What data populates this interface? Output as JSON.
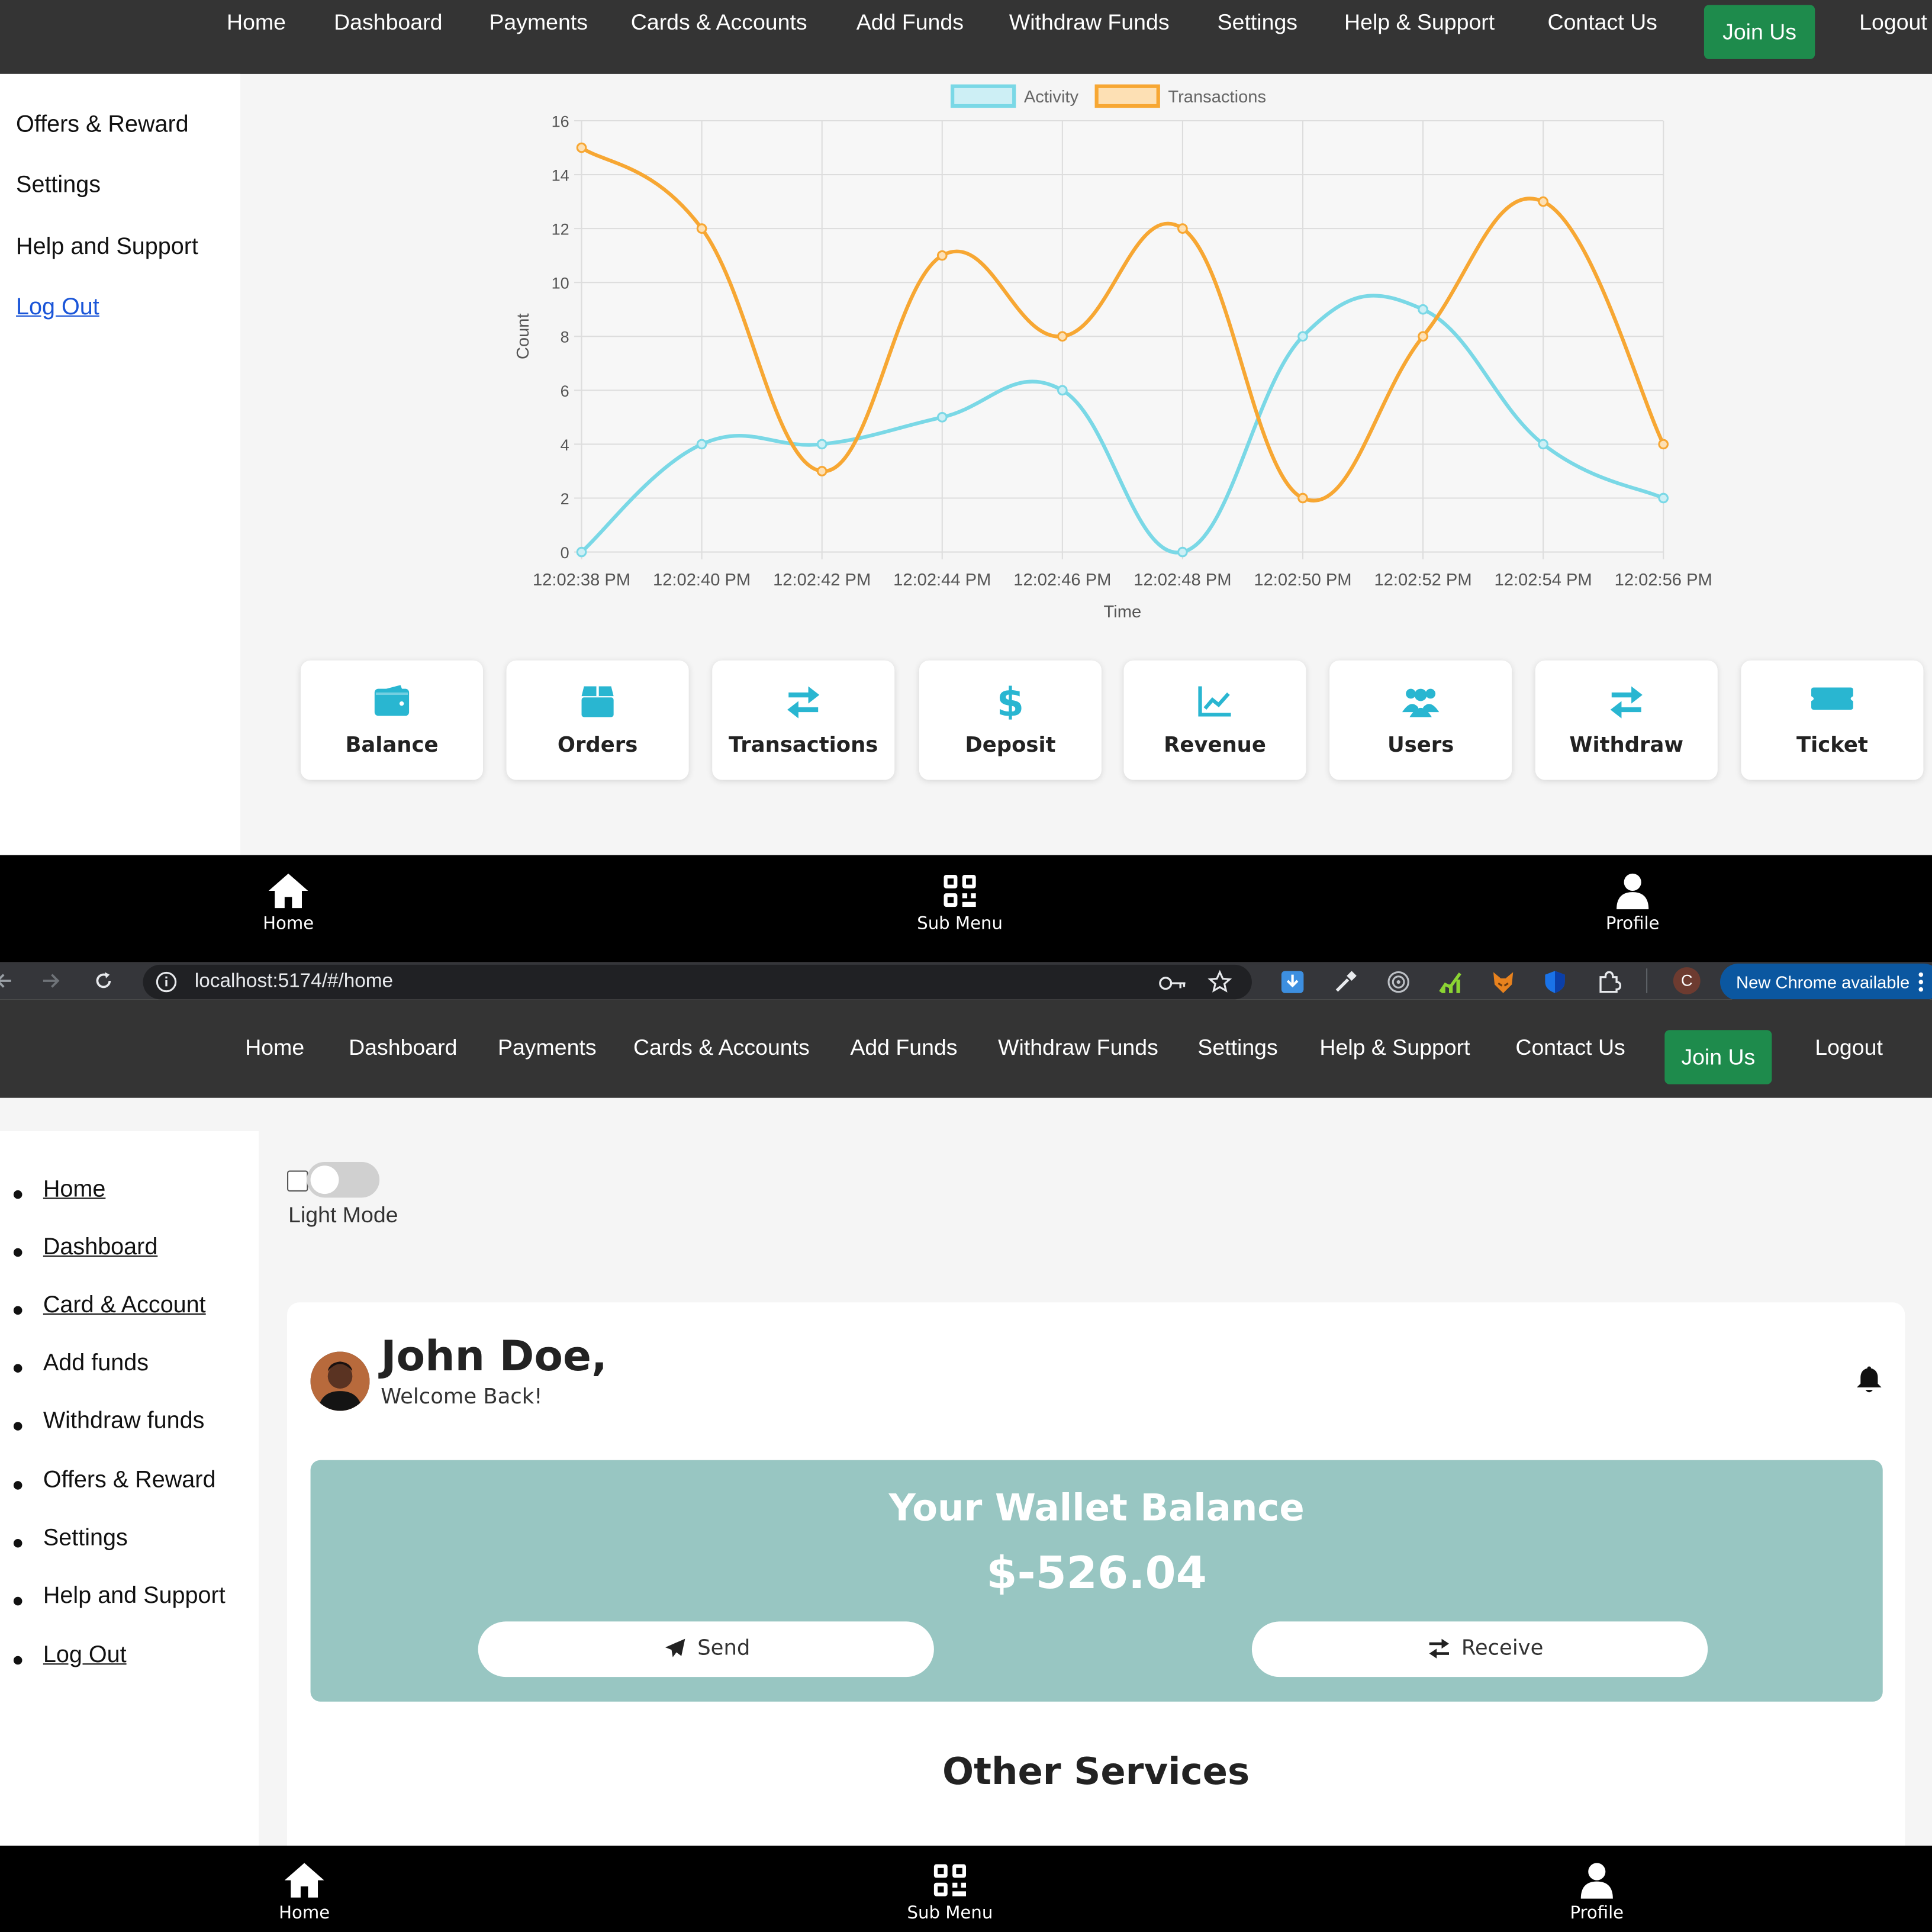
{
  "top_nav": {
    "links": [
      "Home",
      "Dashboard",
      "Payments",
      "Cards & Accounts",
      "Add Funds",
      "Withdraw Funds",
      "Settings",
      "Help & Support",
      "Contact Us"
    ],
    "join_label": "Join Us",
    "logout_label": "Logout"
  },
  "sidebar_top": {
    "items": [
      "Offers & Reward",
      "Settings",
      "Help and Support",
      "Log Out"
    ]
  },
  "chart_data": {
    "type": "line",
    "title": "",
    "xlabel": "Time",
    "ylabel": "Count",
    "ylim": [
      0,
      16
    ],
    "yticks": [
      0,
      2,
      4,
      6,
      8,
      10,
      12,
      14,
      16
    ],
    "grid": true,
    "legend_position": "top-center",
    "categories": [
      "12:02:38 PM",
      "12:02:40 PM",
      "12:02:42 PM",
      "12:02:44 PM",
      "12:02:46 PM",
      "12:02:48 PM",
      "12:02:50 PM",
      "12:02:52 PM",
      "12:02:54 PM",
      "12:02:56 PM"
    ],
    "series": [
      {
        "name": "Activity",
        "color": "#7ad8e6",
        "values": [
          0,
          4,
          4,
          5,
          6,
          0,
          8,
          9,
          4,
          2
        ]
      },
      {
        "name": "Transactions",
        "color": "#f7a733",
        "values": [
          15,
          12,
          3,
          11,
          8,
          12,
          2,
          8,
          13,
          4
        ]
      }
    ]
  },
  "services": [
    {
      "label": "Balance",
      "icon": "wallet-icon"
    },
    {
      "label": "Orders",
      "icon": "box-icon"
    },
    {
      "label": "Transactions",
      "icon": "exchange-icon"
    },
    {
      "label": "Deposit",
      "icon": "dollar-icon"
    },
    {
      "label": "Revenue",
      "icon": "line-chart-icon"
    },
    {
      "label": "Users",
      "icon": "users-icon"
    },
    {
      "label": "Withdraw",
      "icon": "exchange-icon"
    },
    {
      "label": "Ticket",
      "icon": "ticket-icon"
    }
  ],
  "bottom_nav": {
    "home_label": "Home",
    "submenu_label": "Sub Menu",
    "profile_label": "Profile"
  },
  "browser": {
    "url": "localhost:5174/#/home",
    "profile_initial": "C",
    "update_label": "New Chrome available"
  },
  "sidebar_bottom": {
    "items": [
      "Home",
      "Dashboard",
      "Card & Account",
      "Add funds",
      "Withdraw funds",
      "Offers & Reward",
      "Settings",
      "Help and Support",
      "Log Out"
    ]
  },
  "theme_toggle": {
    "label": "Light Mode",
    "checked": false
  },
  "user": {
    "name": "John Doe,",
    "greeting": "Welcome Back!"
  },
  "wallet": {
    "title": "Your Wallet Balance",
    "amount": "$-526.04",
    "send_label": "Send",
    "receive_label": "Receive"
  },
  "other_services_title": "Other Services",
  "colors": {
    "accent": "#29b6d1",
    "join": "#1e8b4c",
    "wallet_bg": "#98c6c2",
    "activity": "#7ad8e6",
    "transactions": "#f7a733"
  }
}
